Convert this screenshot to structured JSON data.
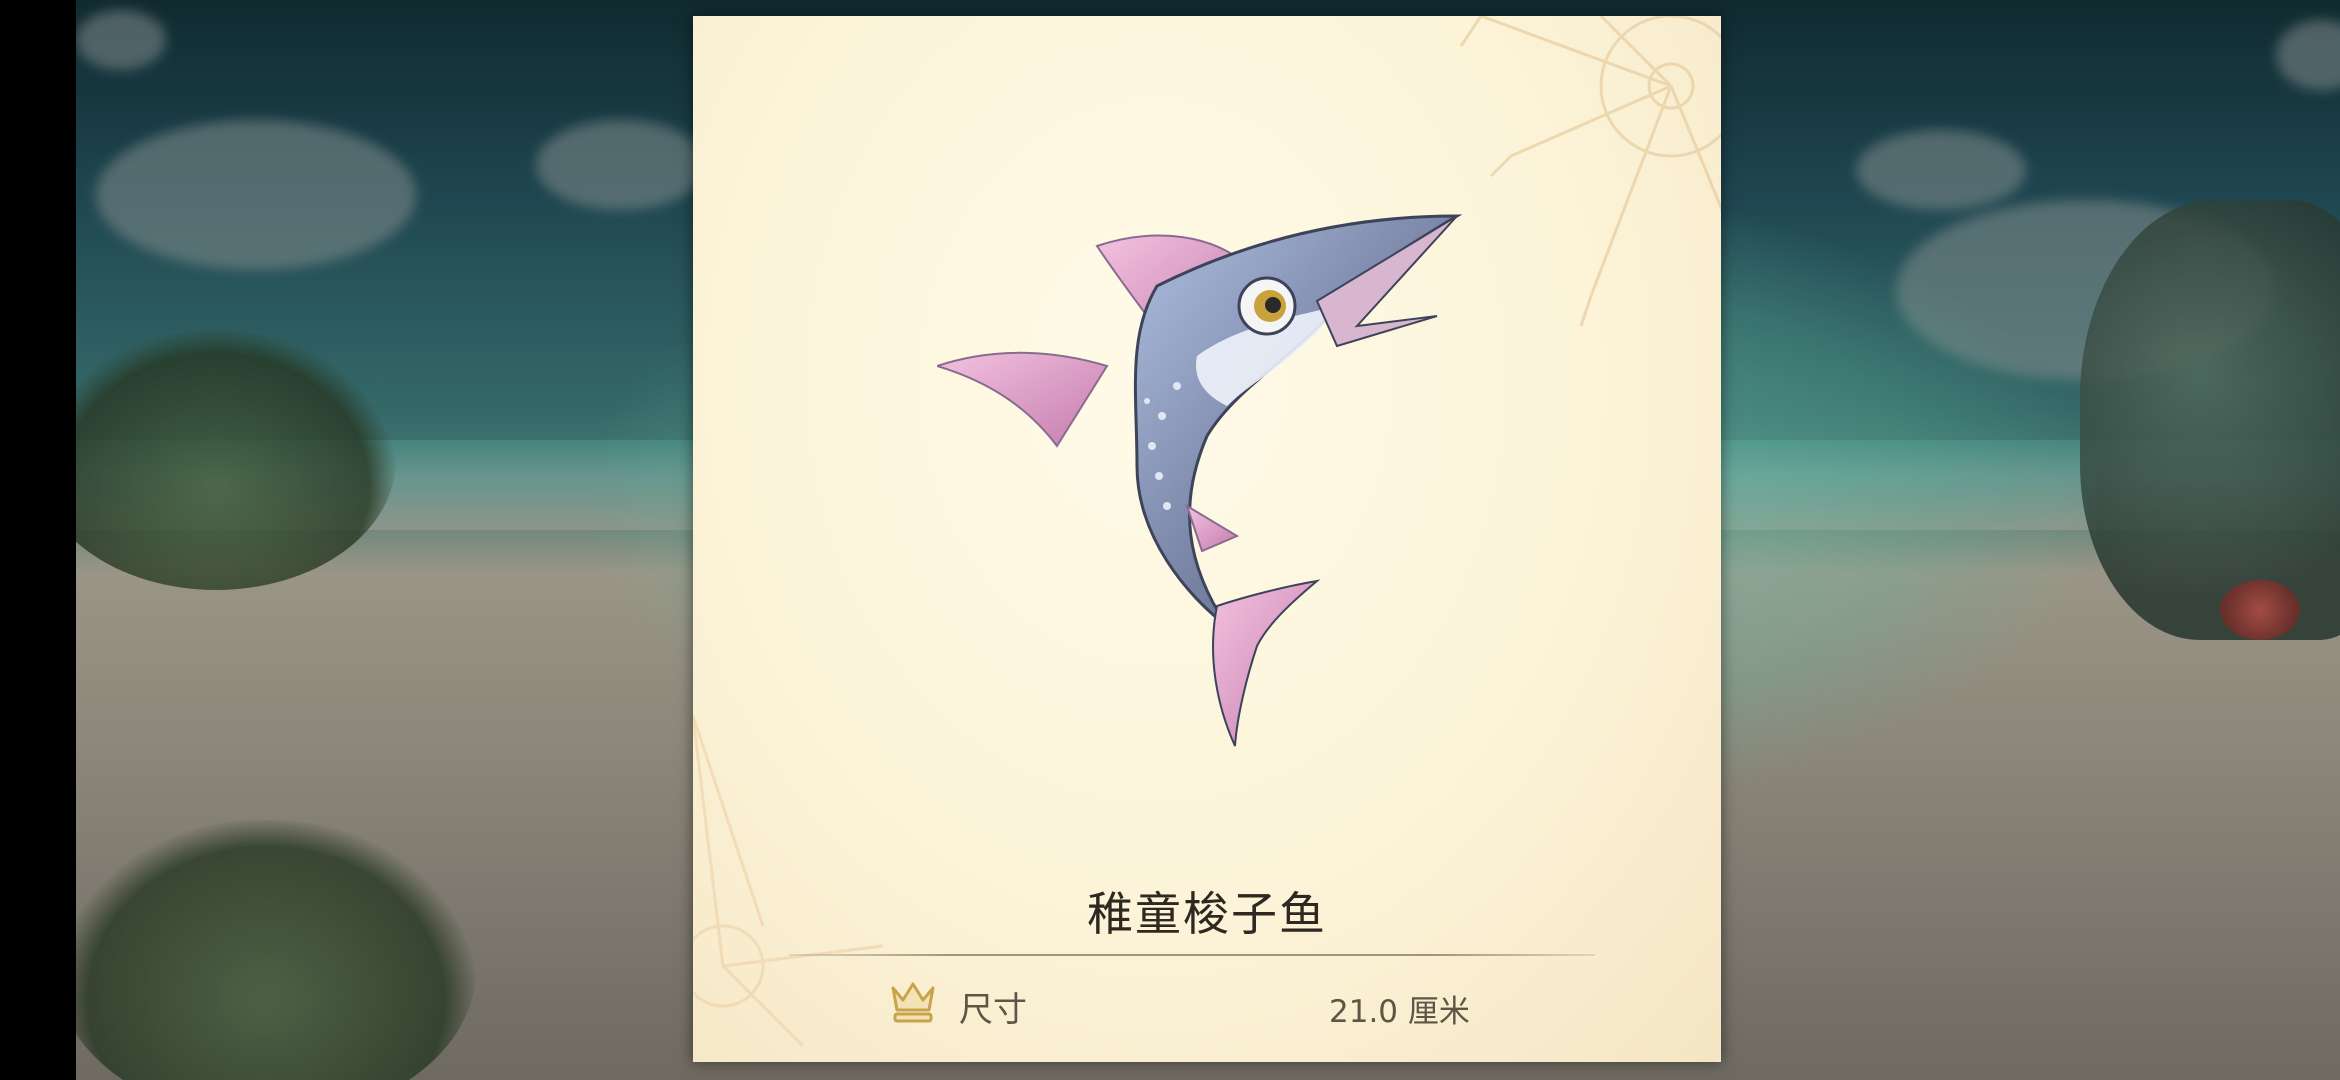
{
  "fish": {
    "name": "稚童梭子鱼",
    "image_icon": "barracuda-fish-illustration"
  },
  "stats": [
    {
      "icon": "crown-icon",
      "label": "尺寸",
      "value": "21.0 厘米"
    }
  ],
  "colors": {
    "card_background": "#fcf3d8",
    "text_dark": "#2e2820",
    "text_muted": "#5d5647",
    "crown_gold": "#c9a24a"
  }
}
